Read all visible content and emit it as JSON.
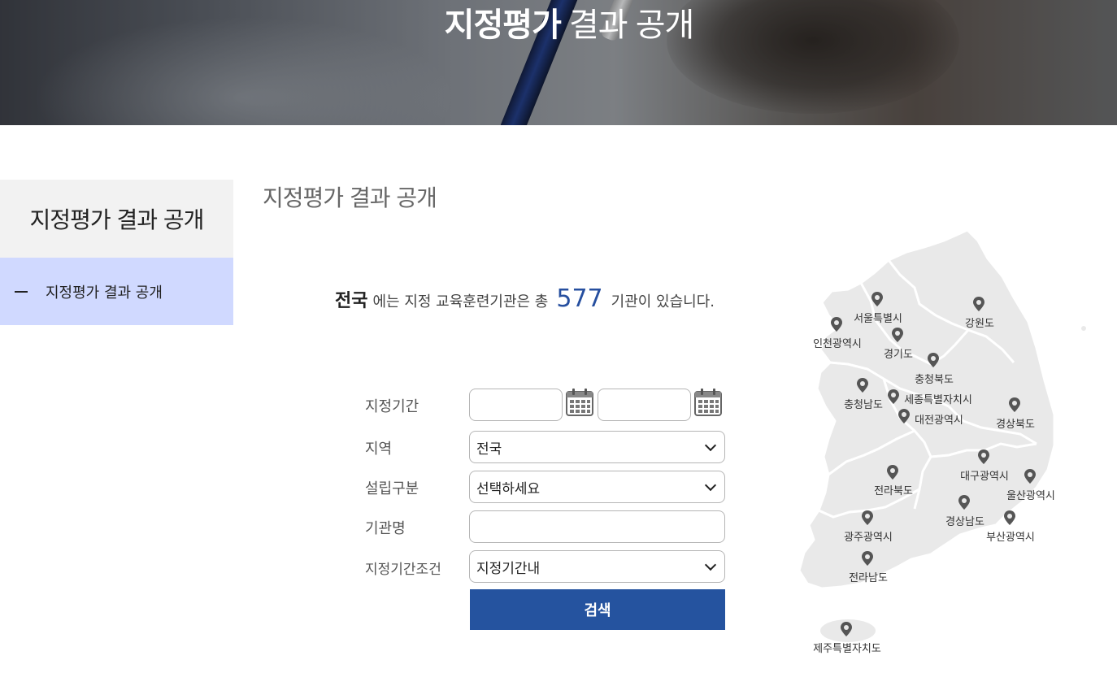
{
  "banner": {
    "title_bold": "지정평가",
    "title_rest": " 결과 공개"
  },
  "sidebar": {
    "heading": "지정평가 결과 공개",
    "items": [
      {
        "label": "지정평가 결과 공개",
        "active": true
      }
    ]
  },
  "main": {
    "title": "지정평가 결과 공개",
    "summary": {
      "region": "전국",
      "text_before": "에는 지정 교육훈련기관은 총",
      "count": "577",
      "text_after": "기관이 있습니다."
    }
  },
  "form": {
    "period_label": "지정기간",
    "period_start": "",
    "period_end": "",
    "region_label": "지역",
    "region_value": "전국",
    "type_label": "설립구분",
    "type_value": "선택하세요",
    "name_label": "기관명",
    "name_value": "",
    "condition_label": "지정기간조건",
    "condition_value": "지정기간내",
    "search_label": "검색"
  },
  "map": {
    "regions": [
      "서울특별시",
      "인천광역시",
      "강원도",
      "경기도",
      "충청북도",
      "충청남도",
      "세종특별자치시",
      "대전광역시",
      "경상북도",
      "대구광역시",
      "울산광역시",
      "전라북도",
      "경상남도",
      "부산광역시",
      "광주광역시",
      "전라남도",
      "제주특별자치도"
    ]
  },
  "colors": {
    "accent": "#25539f",
    "sidebar_active": "#d0d9ff",
    "count": "#264f9f"
  },
  "icons": {
    "calendar": "calendar-icon",
    "pin": "map-pin-icon",
    "dropdown": "chevron-down-icon"
  }
}
